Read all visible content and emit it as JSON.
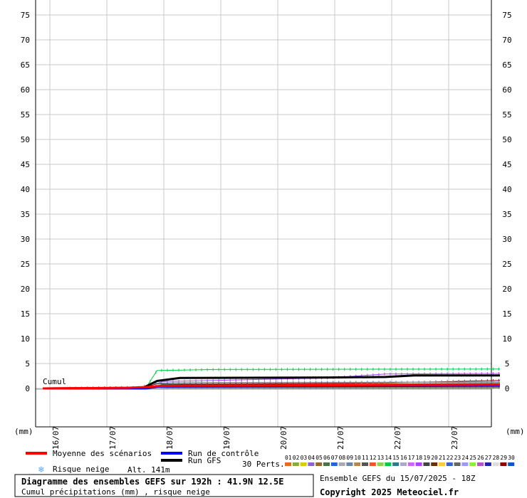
{
  "chart_data": {
    "type": "line",
    "y_ticks": [
      0,
      5,
      10,
      15,
      20,
      25,
      30,
      35,
      40,
      45,
      50,
      55,
      60,
      65,
      70,
      75
    ],
    "ylim": [
      -8,
      78
    ],
    "x_ticks": [
      "16/07",
      "17/07",
      "18/07",
      "19/07",
      "20/07",
      "21/07",
      "22/07",
      "23/07"
    ],
    "xlim": [
      0,
      8
    ],
    "unit_label": "(mm)",
    "series_label": "Cumul",
    "series": [
      {
        "name": "Moyenne des scénarios",
        "color": "#ff0000",
        "width": 3,
        "points": [
          [
            0,
            0
          ],
          [
            1.5,
            0.15
          ],
          [
            1.85,
            0.3
          ],
          [
            2.05,
            0.5
          ],
          [
            2.5,
            0.55
          ],
          [
            4,
            0.6
          ],
          [
            5,
            0.65
          ],
          [
            6.5,
            0.7
          ],
          [
            8,
            0.75
          ]
        ]
      },
      {
        "name": "Run de contrôle",
        "color": "#0000ff",
        "width": 3,
        "points": [
          [
            0,
            0
          ],
          [
            1.8,
            0
          ],
          [
            2.05,
            0.4
          ],
          [
            4,
            0.45
          ],
          [
            8,
            0.55
          ]
        ]
      },
      {
        "name": "Run GFS",
        "color": "#000000",
        "width": 3,
        "points": [
          [
            0,
            0
          ],
          [
            1.75,
            0.1
          ],
          [
            2.0,
            1.5
          ],
          [
            2.4,
            2.1
          ],
          [
            5,
            2.2
          ],
          [
            6,
            2.3
          ],
          [
            6.5,
            2.6
          ],
          [
            8,
            2.6
          ]
        ]
      },
      {
        "name": "14",
        "color": "#00cc44",
        "width": 1,
        "points": [
          [
            0,
            0
          ],
          [
            1.8,
            0
          ],
          [
            2.0,
            3.6
          ],
          [
            3.0,
            3.8
          ],
          [
            8,
            3.9
          ]
        ]
      },
      {
        "name": "18",
        "color": "#aa44ff",
        "width": 1,
        "points": [
          [
            0,
            0
          ],
          [
            1.8,
            0.2
          ],
          [
            2.1,
            1.4
          ],
          [
            3,
            1.6
          ],
          [
            5,
            2.1
          ],
          [
            6,
            2.9
          ],
          [
            8,
            3.0
          ]
        ]
      },
      {
        "name": "29",
        "color": "#8b0000",
        "width": 1,
        "points": [
          [
            0,
            0
          ],
          [
            1.7,
            0.1
          ],
          [
            2.0,
            0.9
          ],
          [
            4,
            1.0
          ],
          [
            6,
            1.1
          ],
          [
            8,
            1.6
          ]
        ]
      },
      {
        "name": "09",
        "color": "#6688aa",
        "width": 1,
        "points": [
          [
            0,
            0
          ],
          [
            1.7,
            0.2
          ],
          [
            1.95,
            1.0
          ],
          [
            2.3,
            1.2
          ],
          [
            8,
            1.3
          ]
        ]
      },
      {
        "name": "19",
        "color": "#444444",
        "width": 1,
        "points": [
          [
            0,
            0
          ],
          [
            1.9,
            0.1
          ],
          [
            2.1,
            0.8
          ],
          [
            6,
            0.9
          ],
          [
            8,
            1.0
          ]
        ]
      },
      {
        "name": "10",
        "color": "#bb8844",
        "width": 1,
        "points": [
          [
            0,
            0
          ],
          [
            1.6,
            0.1
          ],
          [
            1.9,
            0.5
          ],
          [
            5,
            0.6
          ],
          [
            6.4,
            1.2
          ],
          [
            8,
            1.2
          ]
        ]
      },
      {
        "name": "01",
        "color": "#e07020",
        "width": 1,
        "points": [
          [
            0,
            0
          ],
          [
            1.8,
            0
          ],
          [
            2.1,
            0.3
          ],
          [
            6,
            0.35
          ],
          [
            8,
            0.4
          ]
        ]
      },
      {
        "name": "02",
        "color": "#88aa44",
        "width": 1,
        "points": [
          [
            0,
            0
          ],
          [
            1.8,
            0
          ],
          [
            2.0,
            0.2
          ],
          [
            8,
            0.25
          ]
        ]
      },
      {
        "name": "23",
        "color": "#666666",
        "width": 1,
        "points": [
          [
            0,
            0
          ],
          [
            2,
            0
          ],
          [
            2.2,
            0.1
          ],
          [
            8,
            0.15
          ]
        ]
      },
      {
        "name": "25",
        "color": "#aaaaaa",
        "width": 1,
        "points": [
          [
            0,
            0
          ],
          [
            8,
            0
          ]
        ]
      }
    ],
    "legend": {
      "mean": "Moyenne des scénarios",
      "control": "Run de contrôle",
      "gfs": "Run GFS",
      "snow": "Risque neige",
      "altitude": "Alt. 141m",
      "perts": "30 Perts."
    },
    "perturbations": [
      {
        "n": "01",
        "color": "#e07020"
      },
      {
        "n": "02",
        "color": "#88aa44"
      },
      {
        "n": "03",
        "color": "#ddcc00"
      },
      {
        "n": "04",
        "color": "#8866cc"
      },
      {
        "n": "05",
        "color": "#996633"
      },
      {
        "n": "06",
        "color": "#447744"
      },
      {
        "n": "07",
        "color": "#2266dd"
      },
      {
        "n": "08",
        "color": "#aaaaaa"
      },
      {
        "n": "09",
        "color": "#6688aa"
      },
      {
        "n": "10",
        "color": "#bb8844"
      },
      {
        "n": "11",
        "color": "#555555"
      },
      {
        "n": "12",
        "color": "#ee5522"
      },
      {
        "n": "13",
        "color": "#99cc55"
      },
      {
        "n": "14",
        "color": "#00cc44"
      },
      {
        "n": "15",
        "color": "#337788"
      },
      {
        "n": "16",
        "color": "#aaaacc"
      },
      {
        "n": "17",
        "color": "#cc66ff"
      },
      {
        "n": "18",
        "color": "#aa44ff"
      },
      {
        "n": "19",
        "color": "#444444"
      },
      {
        "n": "20",
        "color": "#663300"
      },
      {
        "n": "21",
        "color": "#ffcc33"
      },
      {
        "n": "22",
        "color": "#3366cc"
      },
      {
        "n": "23",
        "color": "#666666"
      },
      {
        "n": "24",
        "color": "#9999ff"
      },
      {
        "n": "25",
        "color": "#88ee44"
      },
      {
        "n": "26",
        "color": "#bb55bb"
      },
      {
        "n": "27",
        "color": "#2222aa"
      },
      {
        "n": "28",
        "color": "#dddddd"
      },
      {
        "n": "29",
        "color": "#8b0000"
      },
      {
        "n": "30",
        "color": "#1155cc"
      }
    ]
  },
  "info": {
    "title": "Diagramme des ensembles GEFS sur 192h : 41.9N 12.5E",
    "subtitle": "Cumul précipitations (mm) , risque neige",
    "run": "Ensemble GEFS du 15/07/2025 - 18Z",
    "copyright": "Copyright 2025 Meteociel.fr"
  }
}
